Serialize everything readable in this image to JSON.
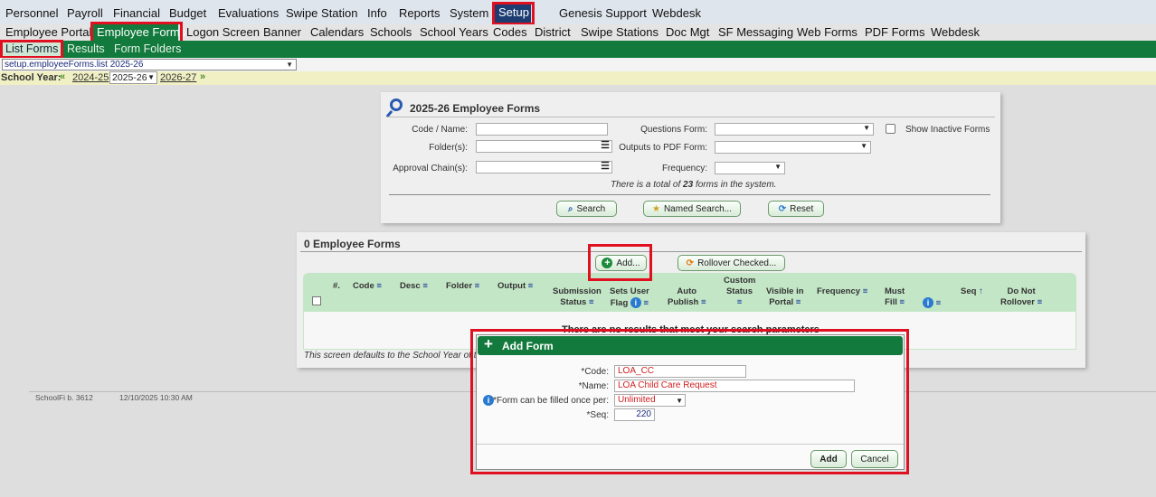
{
  "top_menu": [
    "Personnel",
    "Payroll",
    "Financial",
    "Budget",
    "Evaluations",
    "Swipe Station",
    "Info",
    "Reports",
    "System",
    "Setup",
    "Genesis Support",
    "Webdesk"
  ],
  "sub_menu": [
    "Employee Portal",
    "Employee Forms",
    "Logon Screen",
    "Banner",
    "Calendars",
    "Schools",
    "School Years",
    "Codes",
    "District",
    "Swipe Stations",
    "Doc Mgt",
    "SF Messaging",
    "Web Forms",
    "PDF Forms",
    "Webdesk"
  ],
  "green_tabs": [
    "List Forms",
    "Results",
    "Form Folders"
  ],
  "screen_select": "setup.employeeForms.list 2025-26",
  "school_year": {
    "label": "School Year:",
    "prev": "2024-25",
    "current": "2025-26",
    "next": "2026-27"
  },
  "search": {
    "title": "2025-26 Employee Forms",
    "code_label": "Code / Name:",
    "folder_label": "Folder(s):",
    "approval_label": "Approval Chain(s):",
    "questions_label": "Questions Form:",
    "outputs_label": "Outputs to PDF Form:",
    "frequency_label": "Frequency:",
    "inactive_label": "Show Inactive Forms",
    "total_pre": "There is a total of",
    "total_count": "23",
    "total_post": "forms in the system.",
    "search_btn": "Search",
    "named_btn": "Named Search...",
    "reset_btn": "Reset"
  },
  "list": {
    "title": "0 Employee Forms",
    "add_btn": "Add...",
    "rollover_btn": "Rollover Checked...",
    "no_results": "There are no results that meet your search parameters",
    "footer_note": "This screen defaults to the School Year of to",
    "columns": [
      {
        "l1": "",
        "l2": "#."
      },
      {
        "l1": "",
        "l2": "Code"
      },
      {
        "l1": "",
        "l2": "Desc"
      },
      {
        "l1": "",
        "l2": "Folder"
      },
      {
        "l1": "",
        "l2": "Output"
      },
      {
        "l1": "Submission",
        "l2": "Status"
      },
      {
        "l1": "Sets User",
        "l2": "Flag"
      },
      {
        "l1": "Auto",
        "l2": "Publish"
      },
      {
        "l1": "Custom Status",
        "l2": ""
      },
      {
        "l1": "Visible in",
        "l2": "Portal"
      },
      {
        "l1": "",
        "l2": "Frequency"
      },
      {
        "l1": "Must",
        "l2": "Fill"
      },
      {
        "l1": "",
        "l2": ""
      },
      {
        "l1": "",
        "l2": "Seq"
      },
      {
        "l1": "Do Not",
        "l2": "Rollover"
      }
    ]
  },
  "build": {
    "version": "SchoolFi b. 3612",
    "timestamp": "12/10/2025 10:30 AM"
  },
  "dialog": {
    "title": "Add Form",
    "code_label": "*Code:",
    "code_value": "LOA_CC",
    "name_label": "*Name:",
    "name_value": "LOA Child Care Request",
    "fill_label": "*Form can be filled once per:",
    "fill_value": "Unlimited",
    "seq_label": "*Seq:",
    "seq_value": "220",
    "add_btn": "Add",
    "cancel_btn": "Cancel"
  },
  "colors": {
    "green": "#127a3c",
    "highlight": "#e01020"
  }
}
